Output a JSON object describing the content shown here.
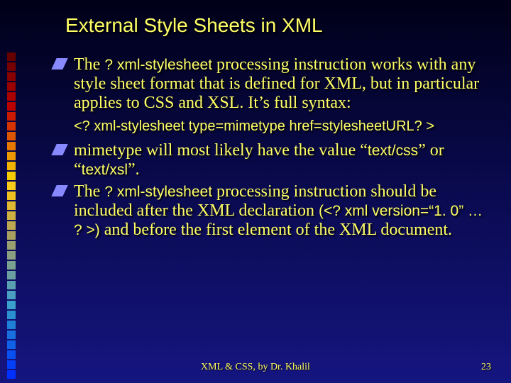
{
  "accent_colors": {
    "square_gradient": [
      "#660000",
      "#770000",
      "#880000",
      "#990000",
      "#aa0000",
      "#bb0000",
      "#cc1a00",
      "#d63300",
      "#dd5500",
      "#e67700",
      "#ee9900",
      "#f2b300",
      "#f6cc00",
      "#facc1a",
      "#eec020",
      "#ddb830",
      "#ccb040",
      "#bba850",
      "#aaa060",
      "#9aa070",
      "#8aa080",
      "#7aa090",
      "#6aa0a0",
      "#5aa0b0",
      "#4aa0c0",
      "#3aa0cc",
      "#2a90d0",
      "#2080d8",
      "#1870e0",
      "#1060e8",
      "#0850f0",
      "#0440f8",
      "#0030ff"
    ],
    "bullet_fill": "#8888ff",
    "text": "#ffff66"
  },
  "title": "External Style Sheets in XML",
  "bullets": {
    "b1": {
      "pre": "The ",
      "code": "? xml-stylesheet",
      "post": " processing instruction works with any style sheet format that is defined for XML, but in particular applies to CSS and XSL. It’s full syntax:"
    },
    "syntax_line": "<? xml-stylesheet type=mimetype href=stylesheetURL? >",
    "b2": {
      "pre": "mimetype will most likely have the value “",
      "code1": "text/css",
      "mid": "” or “",
      "code2": "text/xsl",
      "post": "”."
    },
    "b3": {
      "pre": "The ",
      "code": "? xml-stylesheet",
      "mid": " processing instruction should be included after the XML declaration ",
      "paren": "(<? xml version=“1. 0” … ? >)",
      "post": " and before the first element of the XML document."
    }
  },
  "footer": {
    "center": "XML & CSS, by Dr. Khalil",
    "page": "23"
  }
}
